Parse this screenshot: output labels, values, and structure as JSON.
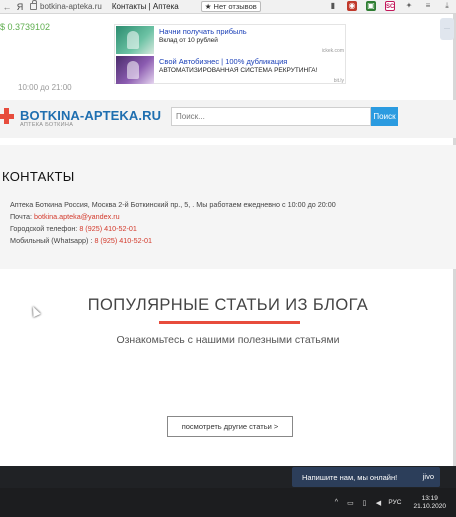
{
  "browser": {
    "ya_label": "Я",
    "url": "botkina-apteka.ru",
    "tab_title": "Контакты | Аптека",
    "reviews_label": "★ Нет отзывов"
  },
  "page_strip": {
    "ticker_value": "$ 0.3739102",
    "hours_text": "10:00 до 21:00"
  },
  "ad": {
    "items": [
      {
        "title": "Начни получать прибыль",
        "subtitle": "Вклад от 10 рублей",
        "source": "ickek.com"
      },
      {
        "title": "Свой Автобизнес | 100% дубликация",
        "subtitle": "АВТОМАТИЗИРОВАННАЯ СИСТЕМА РЕКРУТИНГА!",
        "source": "bit.ly"
      }
    ]
  },
  "header": {
    "logo_text": "BOTKINA-APTEKA.RU",
    "logo_tagline": "АПТЕКА БОТКИНА",
    "search_placeholder": "Поиск...",
    "search_button": "Поиск"
  },
  "contacts": {
    "title": "КОНТАКТЫ",
    "address": "Аптека Боткина Россия, Москва 2-й Боткинский пр., 5, . Мы работаем ежедневно с 10:00 до 20:00",
    "email_label": "Почта:",
    "email_value": "botkina.apteka@yandex.ru",
    "phone_label": "Городской телефон:",
    "phone_value": "8 (925) 410-52-01",
    "mobile_label": "Мобильный (Whatsapp) :",
    "mobile_value": "8 (925) 410-52-01"
  },
  "blog": {
    "title": "ПОПУЛЯРНЫЕ СТАТЬИ ИЗ БЛОГА",
    "subtitle": "Ознакомьтесь с нашими полезными статьями",
    "more_button": "посмотреть другие статьи >"
  },
  "chat": {
    "label": "Напишите нам, мы онлайн!",
    "brand": "jivo"
  },
  "taskbar": {
    "lang": "РУС",
    "time": "13:19",
    "date": "21.10.2020"
  },
  "colors": {
    "accent_red": "#e74c3c",
    "link_blue": "#1f6fb0",
    "search_blue": "#2b9be0",
    "chat_bg": "#2c3e5a"
  }
}
